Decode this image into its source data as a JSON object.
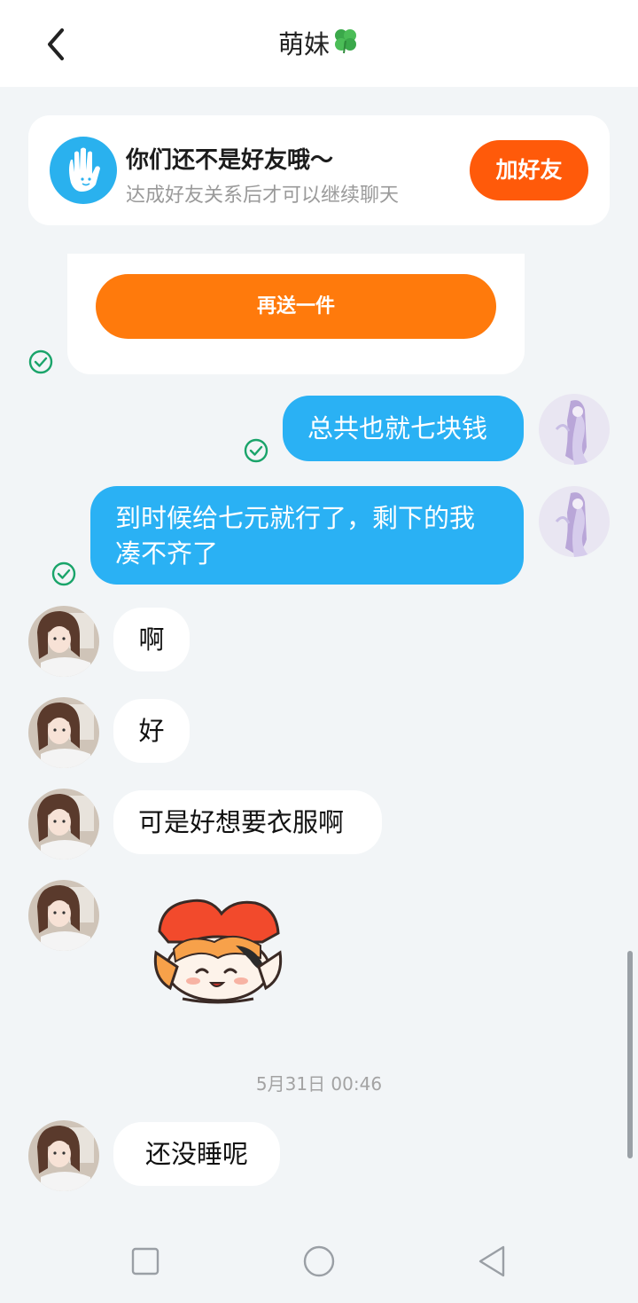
{
  "header": {
    "title": "萌妹",
    "title_emoji_icon": "four-leaf-clover-icon",
    "back_icon": "back-chevron-icon"
  },
  "friend_banner": {
    "icon": "waving-hand-icon",
    "title": "你们还不是好友哦～",
    "subtitle": "达成好友关系后才可以继续聊天",
    "add_button": "加好友",
    "accent": "#ff5a0a"
  },
  "gift_card": {
    "button": "再送一件",
    "accent": "#ff7a0c"
  },
  "messages": [
    {
      "side": "out",
      "text": "总共也就七块钱",
      "status": "check-icon"
    },
    {
      "side": "out",
      "text": "到时候给七元就行了，剩下的我凑不齐了",
      "status": "check-icon"
    },
    {
      "side": "in",
      "text": "啊"
    },
    {
      "side": "in",
      "text": "好"
    },
    {
      "side": "in",
      "text": "可是好想要衣服啊"
    },
    {
      "side": "in",
      "sticker": "cartoon-sticker-icon"
    },
    {
      "side": "in",
      "text": "还没睡呢"
    }
  ],
  "timestamp": "5月31日 00:46",
  "colors": {
    "outgoing_bubble": "#2ab1f4",
    "incoming_bubble": "#ffffff",
    "background": "#f2f5f7",
    "check": "#1aa46a"
  },
  "system_nav": {
    "recents_icon": "square-recents-icon",
    "home_icon": "circle-home-icon",
    "back_icon": "triangle-back-icon"
  }
}
